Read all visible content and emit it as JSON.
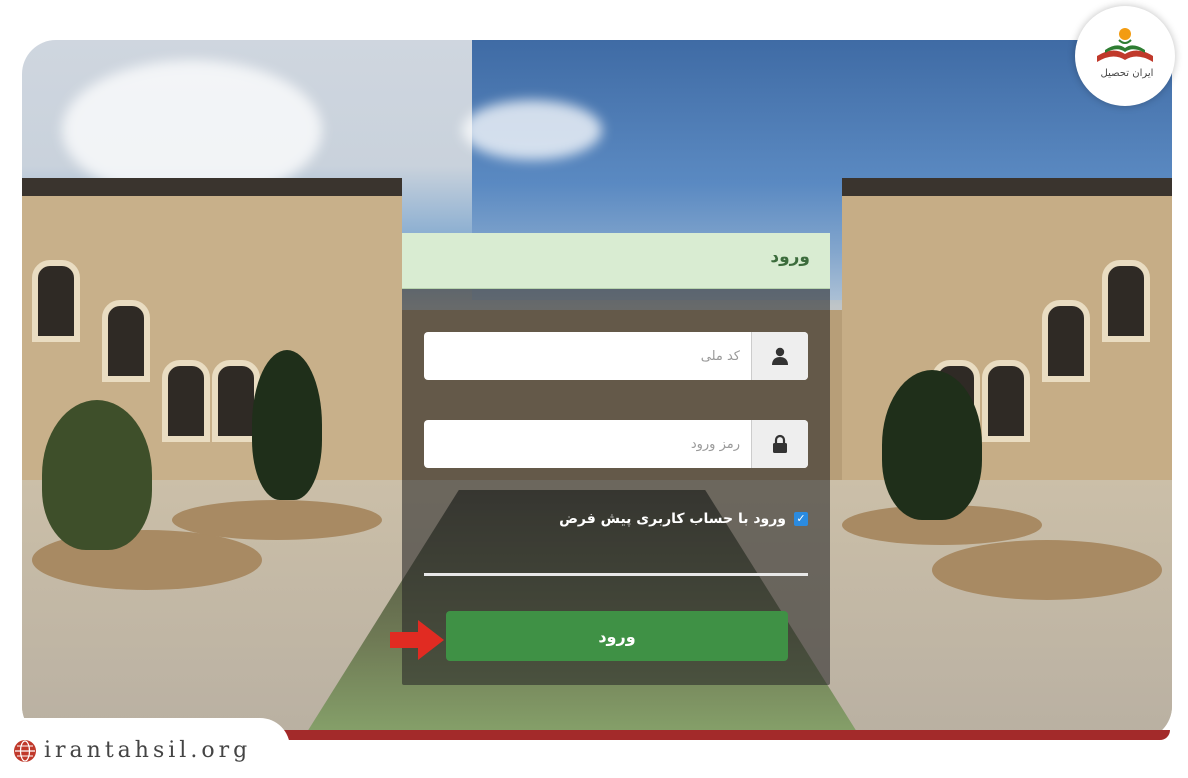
{
  "login": {
    "title": "ورود",
    "national_id_placeholder": "کد ملی",
    "password_placeholder": "رمز ورود",
    "remember_label": "ورود با حساب کاربری پیش فرض",
    "remember_checked": true,
    "submit_label": "ورود"
  },
  "watermark": {
    "site": "irantahsil.org",
    "logo_text": "ایران تحصیل"
  },
  "icons": {
    "user": "user-icon",
    "lock": "lock-icon",
    "checkmark": "checkmark-icon",
    "arrow": "arrow-right-icon",
    "globe": "globe-icon"
  },
  "colors": {
    "header_bg": "#d9ecd2",
    "submit_bg": "#3f9145",
    "arrow": "#e12b22",
    "accent_red": "#a32a2a"
  }
}
